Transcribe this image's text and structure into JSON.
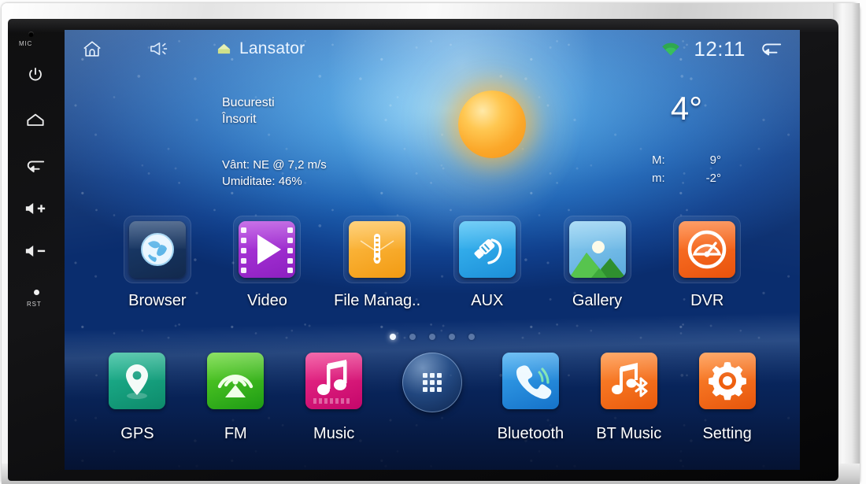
{
  "device": {
    "mic_label": "MIC",
    "reset_label": "RST",
    "hardware_buttons": [
      {
        "name": "power",
        "icon": "power-icon"
      },
      {
        "name": "home",
        "icon": "home-icon"
      },
      {
        "name": "back",
        "icon": "back-arrow-icon"
      },
      {
        "name": "volume-up",
        "icon": "volume-up-icon"
      },
      {
        "name": "volume-down",
        "icon": "volume-down-icon"
      }
    ]
  },
  "statusbar": {
    "home_icon": "home-outline-icon",
    "volume_icon": "speaker-icon",
    "launcher_icon": "launcher-house-icon",
    "title": "Lansator",
    "wifi_icon": "wifi-icon",
    "clock": "12:11",
    "back_icon": "return-arrow-icon",
    "wifi_color": "#2fa84f",
    "text_color": "#eaf4ff"
  },
  "weather": {
    "city": "Bucuresti",
    "condition": "Însorit",
    "wind": "Vânt: NE @ 7,2 m/s",
    "humidity": "Umiditate: 46%",
    "temperature": "4°",
    "high_key": "M:",
    "high_value": "9°",
    "low_key": "m:",
    "low_value": "-2°",
    "sun_icon": "sun-icon",
    "sun_color": "#ffc751"
  },
  "home": {
    "row1": [
      {
        "label": "Browser",
        "icon": "globe-icon",
        "theme": "t-browser"
      },
      {
        "label": "Video",
        "icon": "film-play-icon",
        "theme": "t-video"
      },
      {
        "label": "File Manag..",
        "icon": "file-zipper-icon",
        "theme": "t-file"
      },
      {
        "label": "AUX",
        "icon": "audio-jack-icon",
        "theme": "t-aux"
      },
      {
        "label": "Gallery",
        "icon": "landscape-icon",
        "theme": "t-gallery"
      },
      {
        "label": "DVR",
        "icon": "gauge-icon",
        "theme": "t-dvr"
      }
    ],
    "row2": [
      {
        "label": "GPS",
        "icon": "map-pin-icon",
        "theme": "t-gps"
      },
      {
        "label": "FM",
        "icon": "radio-tower-icon",
        "theme": "t-fm"
      },
      {
        "label": "Music",
        "icon": "music-note-icon",
        "theme": "t-music"
      },
      {
        "label": "Bluetooth",
        "icon": "phone-handset-icon",
        "theme": "t-bt"
      },
      {
        "label": "BT Music",
        "icon": "bt-music-icon",
        "theme": "t-btmusic"
      },
      {
        "label": "Setting",
        "icon": "gear-icon",
        "theme": "t-setting"
      }
    ],
    "app_drawer": {
      "icon": "app-grid-icon",
      "label": ""
    },
    "pages": {
      "count": 5,
      "active": 1
    }
  }
}
